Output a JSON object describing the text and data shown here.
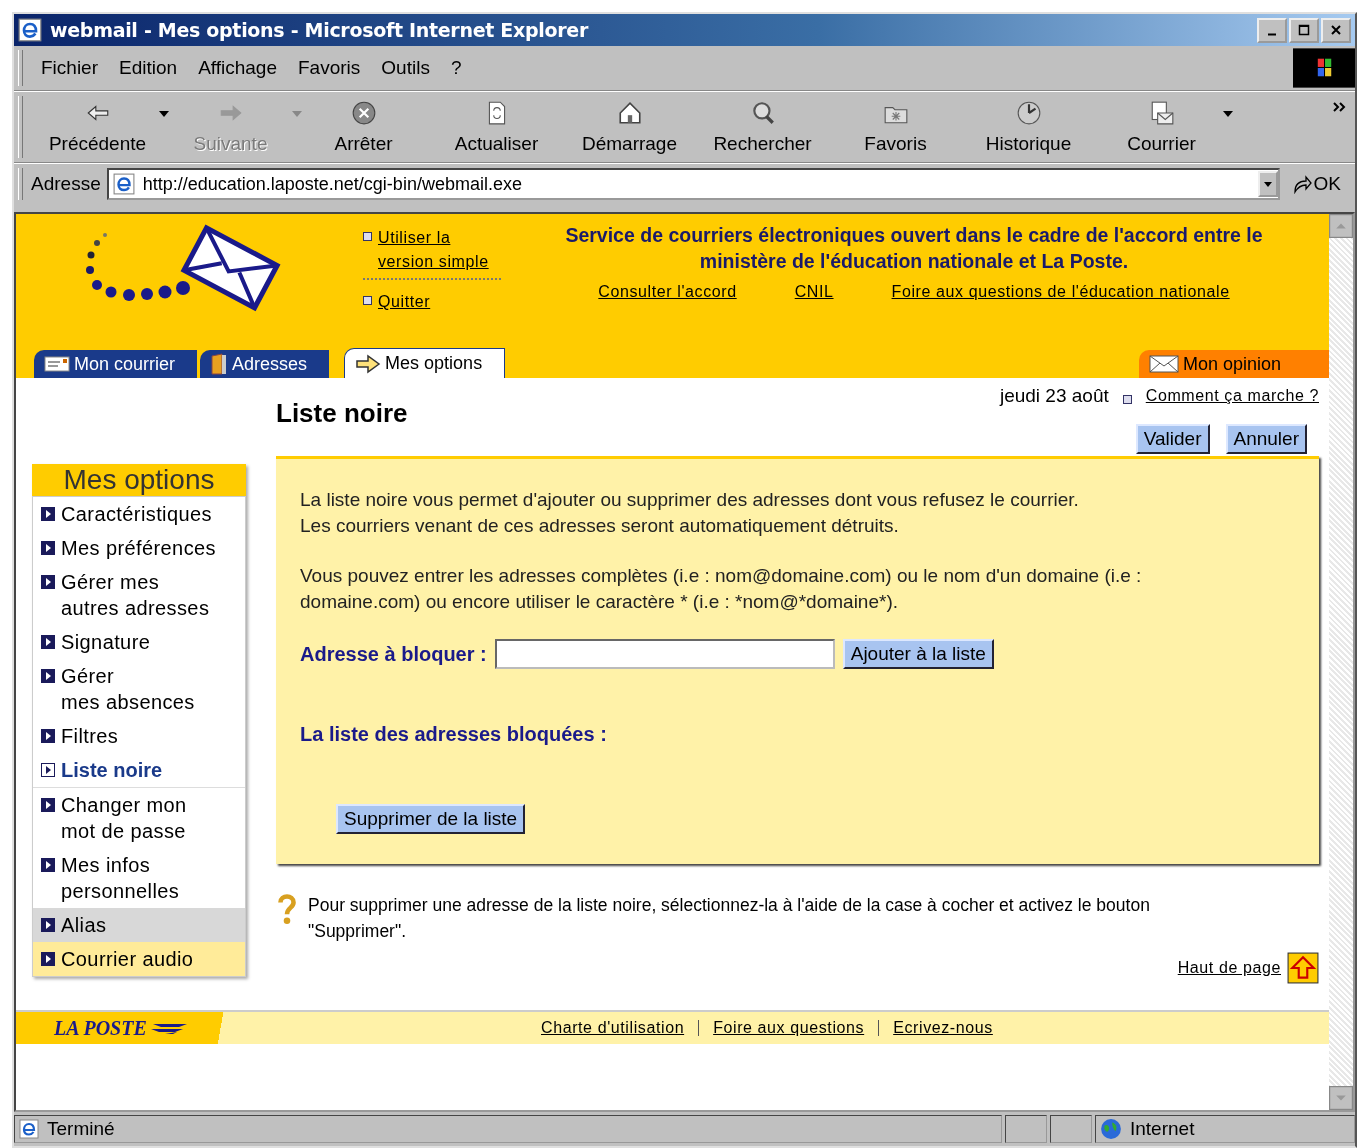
{
  "window": {
    "title": "webmail - Mes options - Microsoft Internet Explorer"
  },
  "menu": [
    "Fichier",
    "Edition",
    "Affichage",
    "Favoris",
    "Outils",
    "?"
  ],
  "toolbar": [
    {
      "label": "Précédente",
      "disabled": false,
      "dropdown": true
    },
    {
      "label": "Suivante",
      "disabled": true,
      "dropdown": true
    },
    {
      "label": "Arrêter",
      "disabled": false,
      "dropdown": false
    },
    {
      "label": "Actualiser",
      "disabled": false,
      "dropdown": false
    },
    {
      "label": "Démarrage",
      "disabled": false,
      "dropdown": false
    },
    {
      "label": "Rechercher",
      "disabled": false,
      "dropdown": false
    },
    {
      "label": "Favoris",
      "disabled": false,
      "dropdown": false
    },
    {
      "label": "Historique",
      "disabled": false,
      "dropdown": false
    },
    {
      "label": "Courrier",
      "disabled": false,
      "dropdown": true
    }
  ],
  "address": {
    "label": "Adresse",
    "value": "http://education.laposte.net/cgi-bin/webmail.exe",
    "go": "OK"
  },
  "header": {
    "side_links": [
      "Utiliser la version simple",
      "Quitter"
    ],
    "title": "Service de courriers électroniques ouvert dans le cadre de l'accord entre le ministère de l'éducation nationale et La Poste.",
    "links": [
      "Consulter l'accord",
      "CNIL",
      "Foire aux questions de l'éducation nationale"
    ]
  },
  "tabs": [
    {
      "label": "Mon courrier",
      "selected": false
    },
    {
      "label": "Adresses",
      "selected": false
    },
    {
      "label": "Mes options",
      "selected": true
    }
  ],
  "opinion_tab": "Mon opinion",
  "date": "jeudi 23 août",
  "help_link": "Comment ça marche ?",
  "page_title": "Liste noire",
  "buttons": [
    "Valider",
    "Annuler"
  ],
  "sidebar": {
    "title": "Mes options",
    "items": [
      {
        "label": "Caractéristiques",
        "selected": false,
        "kind": "plain"
      },
      {
        "label": "Mes préférences",
        "selected": false,
        "kind": "plain"
      },
      {
        "label": "Gérer mes\nautres adresses",
        "selected": false,
        "kind": "plain"
      },
      {
        "label": "Signature",
        "selected": false,
        "kind": "plain"
      },
      {
        "label": "Gérer\nmes absences",
        "selected": false,
        "kind": "plain"
      },
      {
        "label": "Filtres",
        "selected": false,
        "kind": "plain"
      },
      {
        "label": "Liste noire",
        "selected": true,
        "kind": "plain"
      },
      {
        "label": "Changer mon\nmot de passe",
        "selected": false,
        "kind": "plain"
      },
      {
        "label": "Mes infos\npersonnelles",
        "selected": false,
        "kind": "plain"
      },
      {
        "label": "Alias",
        "selected": false,
        "kind": "grey"
      },
      {
        "label": "Courrier audio",
        "selected": false,
        "kind": "yellow"
      }
    ]
  },
  "panel": {
    "paragraphs": [
      "La liste noire vous permet d'ajouter ou supprimer des adresses dont vous refusez le courrier.\nLes courriers venant de ces adresses seront automatiquement détruits.",
      "Vous pouvez entrer les adresses complètes (i.e : nom@domaine.com) ou le nom d'un domaine (i.e : domaine.com) ou encore utiliser le caractère * (i.e : *nom@*domaine*)."
    ],
    "field_label": "Adresse à bloquer :",
    "add_button": "Ajouter à la liste",
    "list_label": "La liste des adresses bloquées :",
    "remove_button": "Supprimer de la liste"
  },
  "hint": "Pour supprimer une adresse de la liste noire, sélectionnez-la à l'aide de la case à cocher et activez le bouton \"Supprimer\".",
  "top_link": "Haut de page",
  "footer": {
    "logo": "LA POSTE",
    "links": [
      "Charte d'utilisation",
      "Foire aux questions",
      "Ecrivez-nous"
    ]
  },
  "status_bar": {
    "text": "Terminé",
    "zone": "Internet"
  }
}
